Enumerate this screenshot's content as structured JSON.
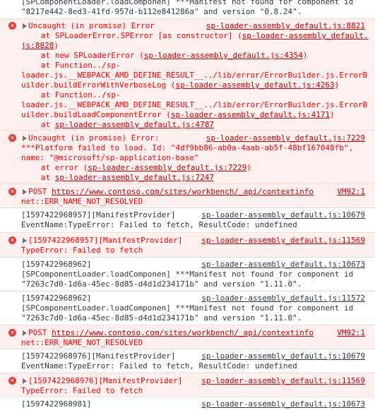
{
  "messages": {
    "m0": {
      "lines": [
        "[SPComponentLoader.loadComponen] ***Manifest not found for component id",
        "\"8217e442-8ed3-41fd-957d-b112e841286a\" and version \"0.8.24\"."
      ]
    },
    "m1": {
      "title": "Uncaught (in promise) Error",
      "src": "sp-loader-assembly_default.js:8821",
      "l1a": "at SPLoaderError.SPError [as constructor] (",
      "l1b": "sp-loader-assembly_default.",
      "l2a": "js:8828",
      "l2b": ")",
      "l3a": "at new SPLoaderError (",
      "l3b": "sp-loader-assembly_default.js:4354",
      "l3c": ")",
      "l4": "at Function../sp-",
      "l5": "loader.js.__WEBPACK_AMD_DEFINE_RESULT__../lib/error/ErrorBuilder.js.ErrorB",
      "l6a": "uilder.buildErrorWithVerboseLog (",
      "l6b": "sp-loader-assembly_default.js:4263",
      "l6c": ")",
      "l7": "at Function../sp-",
      "l8": "loader.js.__WEBPACK_AMD_DEFINE_RESULT__../lib/error/ErrorBuilder.js.ErrorB",
      "l9a": "uilder.buildLoadComponentError (",
      "l9b": "sp-loader-assembly_default.js:4171",
      "l9c": ")",
      "l10a": "at ",
      "l10b": "sp-loader-assembly_default.js:4787"
    },
    "m2": {
      "title": "Uncaught (in promise) Error:",
      "src": "sp-loader-assembly_default.js:7229",
      "l1": "***Platform failed to load. Id: \"4df9bb86-ab0a-4aab-ab5f-48bf167048fb\",",
      "l2": "name: \"@microsoft/sp-application-base\"",
      "l3a": "at error (",
      "l3b": "sp-loader-assembly_default.js:7229",
      "l3c": ")",
      "l4a": "at ",
      "l4b": "sp-loader-assembly_default.js:7247"
    },
    "m3": {
      "method": "POST ",
      "url": "https://www.contoso.com/sites/workbench/_api/contextinfo",
      "src": "VM92:1",
      "l2": "net::ERR_NAME_NOT_RESOLVED"
    },
    "m4": {
      "l1": "[1597422968957][ManifestProvider]",
      "src": "sp-loader-assembly_default.js:10679",
      "l2": "EventName:TypeError: Failed to fetch, ResultCode: undefined"
    },
    "m5": {
      "l1": "[1597422968957][ManifestProvider]",
      "src": "sp-loader-assembly_default.js:11569",
      "l2": "TypeError: Failed to fetch"
    },
    "m6": {
      "l1": "[1597422968962]",
      "src": "sp-loader-assembly_default.js:10673",
      "l2": "[SPComponentLoader.loadComponen] ***Manifest not found for component id",
      "l3": "\"7263c7d0-1d6a-45ec-8d85-d4d1d234171b\" and version \"1.11.0\"."
    },
    "m7": {
      "l1": "[1597422968962]",
      "src": "sp-loader-assembly_default.js:11572",
      "l2": "[SPComponentLoader.loadComponen] ***Manifest not found for component id",
      "l3": "\"7263c7d0-1d6a-45ec-8d85-d4d1d234171b\" and version \"1.11.0\"."
    },
    "m8": {
      "method": "POST ",
      "url": "https://www.contoso.com/sites/workbench/_api/contextinfo",
      "src": "VM92:1",
      "l2": "net::ERR_NAME_NOT_RESOLVED"
    },
    "m9": {
      "l1": "[1597422968976][ManifestProvider]",
      "src": "sp-loader-assembly_default.js:10679",
      "l2": "EventName:TypeError: Failed to fetch, ResultCode: undefined"
    },
    "m10": {
      "l1": "[1597422968976][ManifestProvider]",
      "src": "sp-loader-assembly_default.js:11569",
      "l2": "TypeError: Failed to fetch"
    },
    "m11": {
      "l1": "[1597422968981]",
      "src": "sp-loader-assembly_default.js:10673"
    }
  },
  "icons": {
    "error": "error-circle-icon",
    "expand": "expand-triangle-icon"
  },
  "colors": {
    "error_text": "#ff0000",
    "error_bg": "#fff0f0",
    "error_icon": "#e0413b",
    "log_text": "#303942"
  }
}
